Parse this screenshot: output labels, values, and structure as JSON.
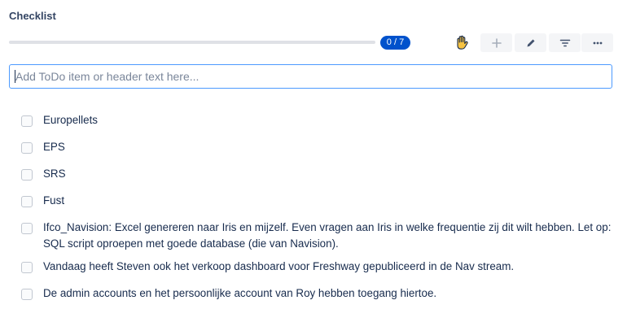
{
  "checklist": {
    "title": "Checklist",
    "progress": {
      "label": "0 / 7",
      "completed": 0,
      "total": 7,
      "fraction": 0
    },
    "toolbar": {
      "hand_icon": "hand-icon",
      "add_icon": "plus-icon",
      "edit_icon": "pencil-icon",
      "filter_icon": "filter-icon",
      "more_icon": "more-icon"
    },
    "input": {
      "placeholder": "Add ToDo item or header text here...",
      "value": ""
    },
    "items": [
      {
        "text": "Europellets",
        "checked": false
      },
      {
        "text": "EPS",
        "checked": false
      },
      {
        "text": "SRS",
        "checked": false
      },
      {
        "text": "Fust",
        "checked": false
      },
      {
        "text": "Ifco_Navision: Excel genereren naar Iris en mijzelf. Even vragen aan Iris in welke frequentie zij dit wilt hebben. Let op: SQL script oproepen met goede database (die van Navision).",
        "checked": false
      },
      {
        "text": "Vandaag heeft Steven ook het verkoop dashboard voor Freshway gepubliceerd in de Nav stream.",
        "checked": false
      },
      {
        "text": "De admin accounts en het persoonlijke account van Roy hebben toegang hiertoe.",
        "checked": false
      }
    ],
    "colors": {
      "accent": "#0052cc",
      "input_border": "#4c9aff",
      "button_bg": "#f4f5f7"
    }
  }
}
